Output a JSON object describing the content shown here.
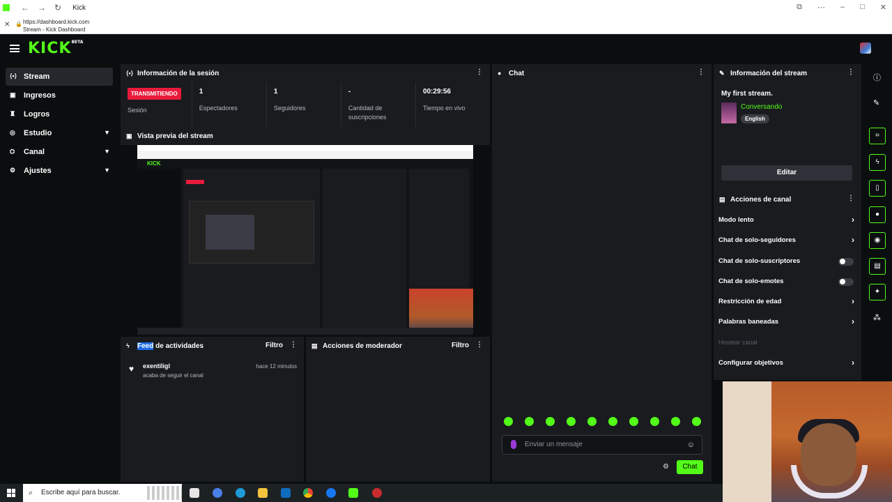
{
  "browser": {
    "tab_title": "Kick",
    "url": "https://dashboard.kick.com",
    "page_title": "Stream - Kick Dashboard"
  },
  "header": {
    "logo": "KICK",
    "logo_badge": "BETA"
  },
  "sidebar": {
    "items": [
      {
        "label": "Stream",
        "icon": "stream-icon",
        "active": true
      },
      {
        "label": "Ingresos",
        "icon": "wallet-icon"
      },
      {
        "label": "Logros",
        "icon": "trophy-icon"
      },
      {
        "label": "Estudio",
        "icon": "studio-icon",
        "expandable": true
      },
      {
        "label": "Canal",
        "icon": "channel-icon",
        "expandable": true
      },
      {
        "label": "Ajustes",
        "icon": "gear-icon",
        "expandable": true
      }
    ]
  },
  "session": {
    "title": "Información de la sesión",
    "status_badge": "TRANSMITIENDO",
    "status_label": "Sesión",
    "stats": [
      {
        "value": "1",
        "label": "Espectadores"
      },
      {
        "value": "1",
        "label": "Seguidores"
      },
      {
        "value": "-",
        "label": "Cantidad de suscripciones"
      },
      {
        "value": "00:29:56",
        "label": "Tiempo en vivo"
      }
    ]
  },
  "preview": {
    "title": "Vista previa del stream"
  },
  "feed": {
    "title_highlight": "Feed",
    "title_rest": " de actividades",
    "filter": "Filtro",
    "items": [
      {
        "name": "exentiligl",
        "action": "acaba de seguir el canal",
        "time": "hace 12 minutos"
      }
    ]
  },
  "moderator": {
    "title": "Acciones de moderador",
    "filter": "Filtro"
  },
  "chat": {
    "title": "Chat",
    "placeholder": "Enviar un mensaje",
    "send_label": "Chat"
  },
  "stream_info": {
    "title": "Información del stream",
    "stream_title": "My first stream.",
    "category": "Conversando",
    "language": "English",
    "edit_label": "Editar"
  },
  "channel_actions": {
    "title": "Acciones de canal",
    "items": [
      {
        "label": "Modo lento",
        "control": "arrow"
      },
      {
        "label": "Chat de solo-seguidores",
        "control": "arrow"
      },
      {
        "label": "Chat de solo-suscriptores",
        "control": "toggle"
      },
      {
        "label": "Chat de solo-emotes",
        "control": "toggle"
      },
      {
        "label": "Restricción de edad",
        "control": "arrow"
      },
      {
        "label": "Palabras baneadas",
        "control": "arrow"
      },
      {
        "label": "Hostear canal",
        "control": "disabled"
      },
      {
        "label": "Configurar objetivos",
        "control": "arrow"
      }
    ]
  },
  "taskbar": {
    "search_placeholder": "Escribe aquí para buscar."
  },
  "colors": {
    "accent": "#53fc18",
    "live": "#e91b3d",
    "panel": "#191b1f",
    "background": "#0b0e0f"
  }
}
